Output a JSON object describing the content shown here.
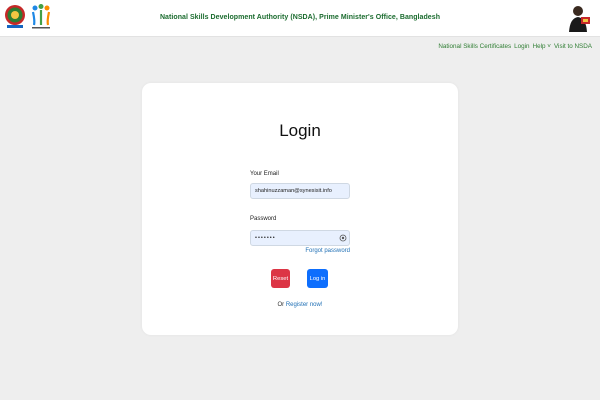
{
  "header": {
    "title": "National Skills Development Authority (NSDA), Prime Minister's Office, Bangladesh",
    "logo_left_icon": "bangladesh-govt-seal-icon",
    "logo_second_icon": "nsda-logo-icon",
    "logo_right_icon": "portrait-icon"
  },
  "nav": {
    "certificates": "National Skills Certificates",
    "login": "Login",
    "help": "Help",
    "help_caret": "˅",
    "visit": "Visit to NSDA"
  },
  "login": {
    "title": "Login",
    "email_label": "Your Email",
    "email_value": "shahinuzzaman@synesisit.info",
    "password_label": "Password",
    "password_value": "•••••••",
    "forgot": "Forgot password",
    "reset_button": "Reset",
    "login_button": "Log in",
    "register_prefix": "Or",
    "register_link": "Register now!"
  },
  "colors": {
    "header_title": "#1a6b2e",
    "reset": "#dc3545",
    "login": "#0d6efd",
    "link": "#1f6fb5"
  }
}
